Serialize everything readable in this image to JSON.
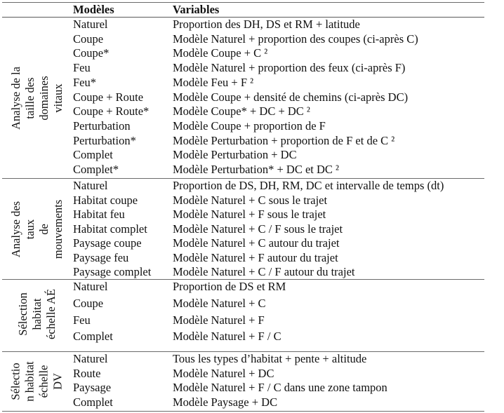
{
  "table": {
    "headers": {
      "group": "",
      "models": "Modèles",
      "variables": "Variables"
    },
    "sections": [
      {
        "label": "Analyse de la taille des\ndomaines vitaux",
        "rows": [
          {
            "model": "Naturel",
            "variables": "Proportion des DH, DS et RM + latitude"
          },
          {
            "model": "Coupe",
            "variables": "Modèle Naturel + proportion des coupes (ci-après C)"
          },
          {
            "model": "Coupe*",
            "variables": "Modèle Coupe + C ²"
          },
          {
            "model": "Feu",
            "variables": "Modèle Naturel + proportion des feux (ci-après F)"
          },
          {
            "model": "Feu*",
            "variables": "Modèle Feu + F ²"
          },
          {
            "model": "Coupe + Route",
            "variables": "Modèle Coupe + densité de chemins (ci-après DC)"
          },
          {
            "model": "Coupe + Route*",
            "variables": "Modèle Coupe* + DC + DC ²"
          },
          {
            "model": "Perturbation",
            "variables": "Modèle Coupe + proportion de F"
          },
          {
            "model": "Perturbation*",
            "variables": "Modèle Perturbation + proportion de F et de C ²"
          },
          {
            "model": "Complet",
            "variables": "Modèle Perturbation + DC"
          },
          {
            "model": "Complet*",
            "variables": "Modèle Perturbation* + DC et DC ²"
          }
        ]
      },
      {
        "label": "Analyse des taux\nde mouvements",
        "rows": [
          {
            "model": "Naturel",
            "variables": "Proportion de DS, DH, RM, DC et intervalle de temps (dt)"
          },
          {
            "model": "Habitat coupe",
            "variables": "Modèle Naturel + C sous le trajet"
          },
          {
            "model": "Habitat feu",
            "variables": "Modèle Naturel + F sous le trajet"
          },
          {
            "model": "Habitat complet",
            "variables": "Modèle Naturel + C / F sous le trajet"
          },
          {
            "model": "Paysage coupe",
            "variables": "Modèle Naturel + C autour du trajet"
          },
          {
            "model": "Paysage feu",
            "variables": "Modèle Naturel + F autour du trajet"
          },
          {
            "model": "Paysage complet",
            "variables": "Modèle Naturel + C / F autour du trajet"
          }
        ]
      },
      {
        "label": "Sélection\nhabitat\néchelle AÉ",
        "rows": [
          {
            "model": "Naturel",
            "variables": "Proportion de DS et RM"
          },
          {
            "model": "Coupe",
            "variables": "Modèle Naturel + C"
          },
          {
            "model": "Feu",
            "variables": "Modèle Naturel + F"
          },
          {
            "model": "Complet",
            "variables": "Modèle Naturel + F / C"
          }
        ]
      },
      {
        "label": "Sélectio\nn habitat\néchelle\nDV",
        "rows": [
          {
            "model": "Naturel",
            "variables": "Tous les types d’habitat + pente + altitude"
          },
          {
            "model": "Route",
            "variables": "Modèle Naturel + DC"
          },
          {
            "model": "Paysage",
            "variables": "Modèle Naturel + F / C dans une zone tampon"
          },
          {
            "model": "Complet",
            "variables": "Modèle Paysage + DC"
          }
        ]
      }
    ]
  }
}
